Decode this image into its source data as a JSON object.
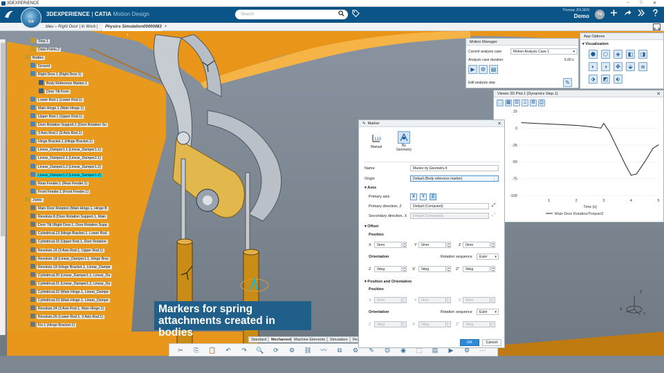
{
  "window": {
    "title": "3DEXPERIENCE",
    "controls": [
      "–",
      "□",
      "✕"
    ]
  },
  "header": {
    "brand_main": "3DEXPERIENCE",
    "brand_sep": " | ",
    "brand_app": "CATIA",
    "brand_sub": " Motion Design",
    "compass_version": "V.R",
    "search_placeholder": "Search",
    "user_name": "Thomas JOLSEN",
    "user_space": "Demo",
    "avatar_initials": "TG",
    "icons": [
      "search-icon",
      "tag-icon",
      "plus-icon",
      "share-icon",
      "collaboration-icon",
      "help-icon"
    ]
  },
  "tabs": [
    {
      "label": "bleu – Right Door | In Work |"
    },
    {
      "label": "Physics Simulation00000083"
    },
    {
      "label": "+"
    }
  ],
  "tree": {
    "items": [
      {
        "label": "Step.1",
        "type": "f"
      },
      {
        "label": "Data Points.2",
        "type": "f"
      },
      {
        "label": "Bodies",
        "type": "f"
      },
      {
        "label": "Ground",
        "type": "b"
      },
      {
        "label": "Right Door.1 (Right Door.1)",
        "type": "b"
      },
      {
        "label": "Body Reference Marker.1",
        "type": "m"
      },
      {
        "label": "Door Tilt From",
        "type": "m"
      },
      {
        "label": "Lower Rod.1 (Lower Rod.1)",
        "type": "b"
      },
      {
        "label": "Main Hinge.1 (Main Hinge.1)",
        "type": "b"
      },
      {
        "label": "Upper Rod.1 (Upper Rod.1)",
        "type": "b"
      },
      {
        "label": "Door Rotation Support.1 (Door Rotation Su",
        "type": "b"
      },
      {
        "label": "3 Axis Rod.1 (3 Axis Rod.1)",
        "type": "b"
      },
      {
        "label": "Hinge Bracket.1 (Hinge Bracket.1)",
        "type": "b"
      },
      {
        "label": "Linear_Damper1.1 (Linear_Damper1.1)",
        "type": "b"
      },
      {
        "label": "Linear_Damper2.1 (Linear_Damper2.1)",
        "type": "b"
      },
      {
        "label": "Linear_Damper1.2 (Linear_Damper1.2)",
        "type": "b"
      },
      {
        "label": "Linear_Damper1.2 (Linear_Damper1.2)",
        "type": "b",
        "selected": true
      },
      {
        "label": "Rear Fender.1 (Rear Fender.1)",
        "type": "b"
      },
      {
        "label": "Front Fender.1 (Front Fender.1)",
        "type": "b"
      },
      {
        "label": "Joints",
        "type": "f"
      },
      {
        "label": "Main Door Rotation (Main Hinge.1, Hinge B",
        "type": "j"
      },
      {
        "label": "Revolute.8 (Door Rotation Support.1, Main",
        "type": "j"
      },
      {
        "label": "Door Tilt (Right Door.1, Door Rotation Supp",
        "type": "j"
      },
      {
        "label": "Cylindrical.13 (Hinge Bracket.1, Lower Rod.",
        "type": "j"
      },
      {
        "label": "Cylindrical.15 (Upper Rod.1, Door Rotation",
        "type": "j"
      },
      {
        "label": "Revolute.16 (3 Axis Rod.1, Upper Rod.1)",
        "type": "j"
      },
      {
        "label": "Revolute.18 (Linear_Damper1.1, Hinge Brac",
        "type": "j"
      },
      {
        "label": "Revolute.19 (Hinge Bracket.1, Linear_Dampe",
        "type": "j"
      },
      {
        "label": "Cylindrical.20 (Linear_Damper1.1, Linear_Da",
        "type": "j"
      },
      {
        "label": "Cylindrical.21 (Linear_Damper1.2, Linear_Da",
        "type": "j"
      },
      {
        "label": "Cylindrical.22 (Main Hinge.1, Linear_Dampe",
        "type": "j"
      },
      {
        "label": "Cylindrical.23 (Main Hinge.1, Linear_Dampe",
        "type": "j"
      },
      {
        "label": "Revolute.24 (3 Axis Rod.1, Main Hinge.1)",
        "type": "j"
      },
      {
        "label": "Revolute.26 (Lower Rod.1, 3 Axis Rod.1)",
        "type": "j"
      },
      {
        "label": "Fix.1 (Hinge Bracket.1)",
        "type": "j"
      }
    ]
  },
  "caption": {
    "line1": "Markers for spring",
    "line2": "attachments created in bodies"
  },
  "section_tabs": [
    "Standard",
    "Mechanism",
    "Machine Elements",
    "Simulation",
    "Res"
  ],
  "motion_manager": {
    "title": "Motion Manager",
    "analysis_case_label": "Current analysis case",
    "analysis_case_value": "Motion Analysis Case.1",
    "duration_label": "Analysis case duration:",
    "duration_value": "5.00 s",
    "edit_step_label": "Edit analysis step"
  },
  "app_options": {
    "title": "App Options",
    "section": "Visualization"
  },
  "viewer": {
    "title": "Viewer 2D Plot.1 (Dynamics Step.1)",
    "legend": "Main Door Rotation/Torque/Z",
    "xlabel": "Time [s]"
  },
  "chart_data": {
    "type": "line",
    "title": "",
    "xlabel": "Time [s]",
    "ylabel": "",
    "xlim": [
      0,
      5
    ],
    "ylim": [
      -100,
      25
    ],
    "xticks": [
      1,
      2,
      3,
      4,
      5
    ],
    "yticks": [
      25,
      0,
      -25,
      -50,
      -75,
      -100
    ],
    "series": [
      {
        "name": "Main Door Rotation/Torque/Z",
        "x": [
          0,
          0.5,
          1,
          1.5,
          2,
          2.5,
          2.9,
          3.0,
          3.2,
          3.5,
          3.8,
          4.0,
          4.2,
          4.5,
          4.8,
          5.0
        ],
        "y": [
          8,
          7,
          6,
          5,
          4,
          2,
          0,
          7,
          -5,
          -30,
          -55,
          -70,
          -68,
          -50,
          -30,
          -25
        ]
      }
    ]
  },
  "marker": {
    "title": "Marker",
    "mode_manual": "Manual",
    "mode_bygeometry_1": "By",
    "mode_bygeometry_2": "Geometry",
    "name_label": "Name",
    "name_value": "Marker by Geometry.4",
    "origin_label": "Origin",
    "origin_value": "Default (Body reference marker)",
    "axes_title": "Axes",
    "primary_axis_label": "Primary axis",
    "axis_x": "X",
    "axis_y": "Y",
    "axis_z": "Z",
    "primary_dir_label": "Primary direction, Z",
    "primary_dir_value": "Default (Computed)",
    "secondary_dir_label": "Secondary direction, X",
    "secondary_dir_value": "Default (Computed)",
    "offset_title": "Offset",
    "position_label": "Position",
    "x_label": "X",
    "y_label": "Y",
    "z_label": "Z",
    "pos_x": "0mm",
    "pos_y": "0mm",
    "pos_z": "0mm",
    "orientation_label": "Orientation",
    "rotation_sequence_label": "Rotation sequence",
    "rotation_sequence_value": "Euler",
    "z_rot_label": "Z",
    "xp_label": "X'",
    "zpp_label": "Z''",
    "rot_z": "0deg",
    "rot_xp": "0deg",
    "rot_zpp": "0deg",
    "pos_orient_title": "Position and Orientation",
    "po_position_label": "Position",
    "po_x": "0mm",
    "po_y": "0mm",
    "po_z": "0mm",
    "po_orientation_label": "Orientation",
    "po_rotation_sequence_value": "Euler",
    "po_rot_z": "0deg",
    "po_rot_xp": "0deg",
    "po_rot_zpp": "0deg",
    "ok": "OK",
    "cancel": "Cancel"
  },
  "triad": {
    "x": "X",
    "y": "Y",
    "z": "Z"
  },
  "colors": {
    "header": "#0a5487",
    "accent": "#2d8ad8",
    "selection": "#13d8e8",
    "part_orange": "#e79a1e"
  }
}
